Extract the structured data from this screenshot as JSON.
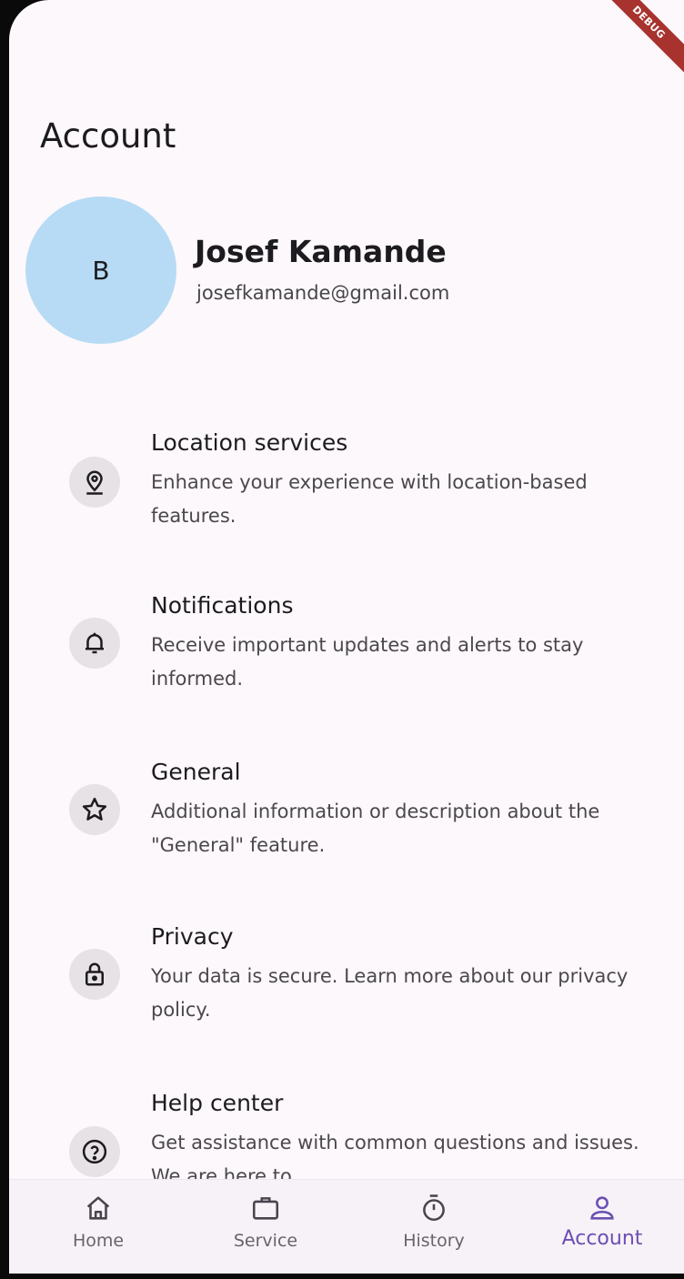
{
  "debug_banner": "DEBUG",
  "header": {
    "title": "Account"
  },
  "profile": {
    "avatar_initial": "B",
    "name": "Josef Kamande",
    "email": "josefkamande@gmail.com",
    "avatar_color": "#b7dbf4"
  },
  "settings": [
    {
      "icon": "location-pin-icon",
      "title": "Location services",
      "description": "Enhance your experience with location-based features."
    },
    {
      "icon": "bell-icon",
      "title": "Notifications",
      "description": "Receive important updates and alerts to stay informed."
    },
    {
      "icon": "star-icon",
      "title": "General",
      "description": "Additional information or description about the \"General\" feature."
    },
    {
      "icon": "lock-icon",
      "title": "Privacy",
      "description": "Your data is secure. Learn more about our privacy policy."
    },
    {
      "icon": "help-icon",
      "title": "Help center",
      "description": "Get assistance with common questions and issues. We are here to"
    }
  ],
  "bottom_nav": {
    "items": [
      {
        "icon": "home-icon",
        "label": "Home"
      },
      {
        "icon": "briefcase-icon",
        "label": "Service"
      },
      {
        "icon": "stopwatch-icon",
        "label": "History"
      },
      {
        "icon": "person-icon",
        "label": "Account"
      }
    ],
    "active": "Account",
    "active_color": "#6b4fb3"
  }
}
